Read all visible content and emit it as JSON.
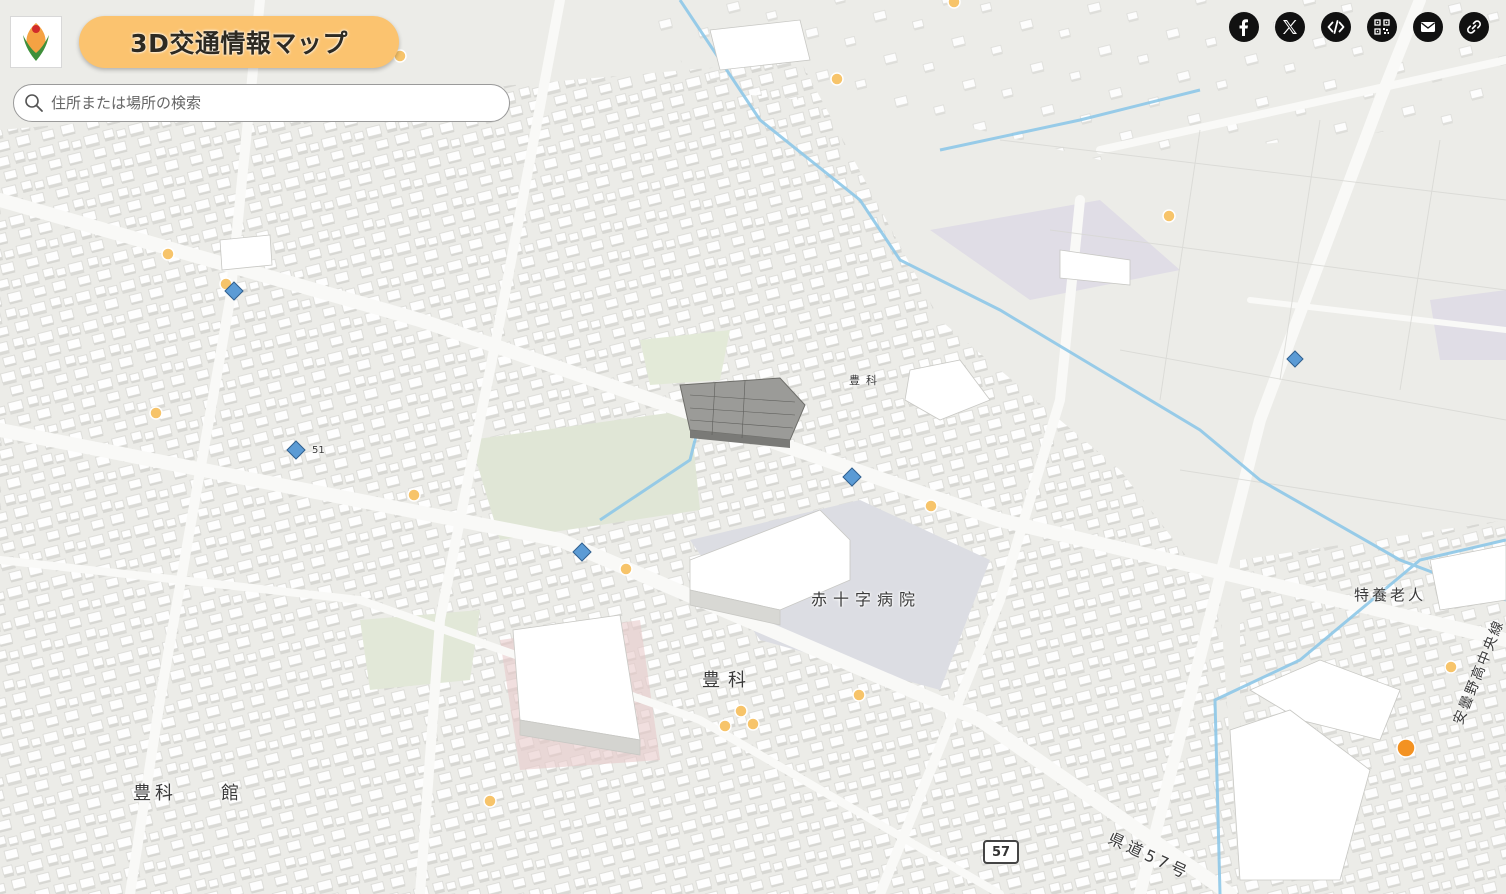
{
  "header": {
    "app_title": "3D交通情報マップ",
    "logo_icon": "municipal-emblem-icon"
  },
  "search": {
    "placeholder": "住所または場所の検索",
    "value": ""
  },
  "share_buttons": [
    {
      "icon": "facebook-icon"
    },
    {
      "icon": "x-icon"
    },
    {
      "icon": "embed-code-icon"
    },
    {
      "icon": "qr-code-icon"
    },
    {
      "icon": "email-icon"
    },
    {
      "icon": "link-icon"
    }
  ],
  "map": {
    "labels": {
      "hospital": "赤十字病院",
      "area_toyoshina": "豊科",
      "hall": "豊科　　館",
      "elder_care": "特養老人",
      "area_toyoshina_top": "豊科",
      "prefectural_road_57": "県道57号",
      "azumino_high_line": "安曇野高中央線",
      "route_number": "57",
      "road_number_51": "51"
    },
    "colors": {
      "map_background": "#ecece8",
      "building": "#ffffff",
      "road": "#f7f7f5",
      "river": "#8ec8e8",
      "poi_marker": "#f7c46a",
      "poi_marker_large": "#f39222",
      "traffic_marker": "#5b9bd5",
      "title_pill": "#fbc36f"
    }
  }
}
